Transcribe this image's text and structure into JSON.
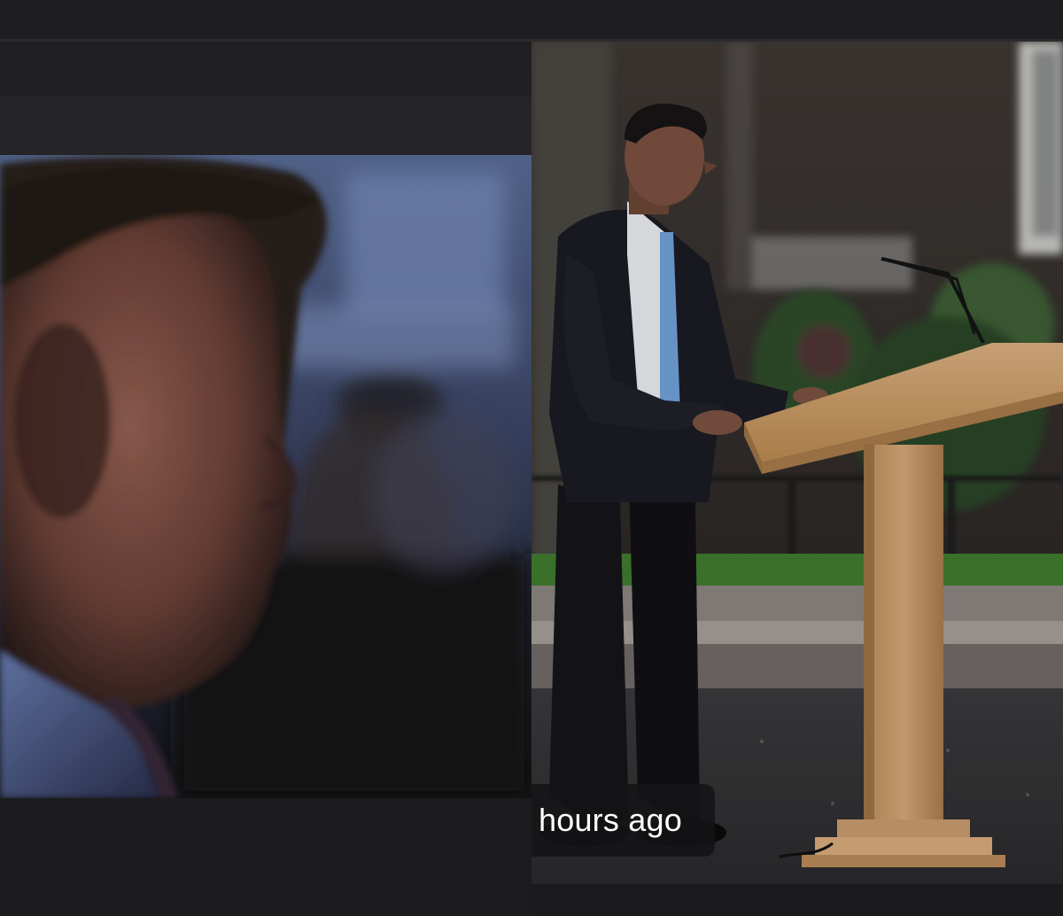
{
  "colors": {
    "background": "#1b1b1d",
    "badge_background": "#141416",
    "badge_text": "#ffffff"
  },
  "images": {
    "left": "man-profile-photo",
    "right": "man-at-podium-photo"
  },
  "right_card": {
    "timestamp": "hours ago"
  }
}
